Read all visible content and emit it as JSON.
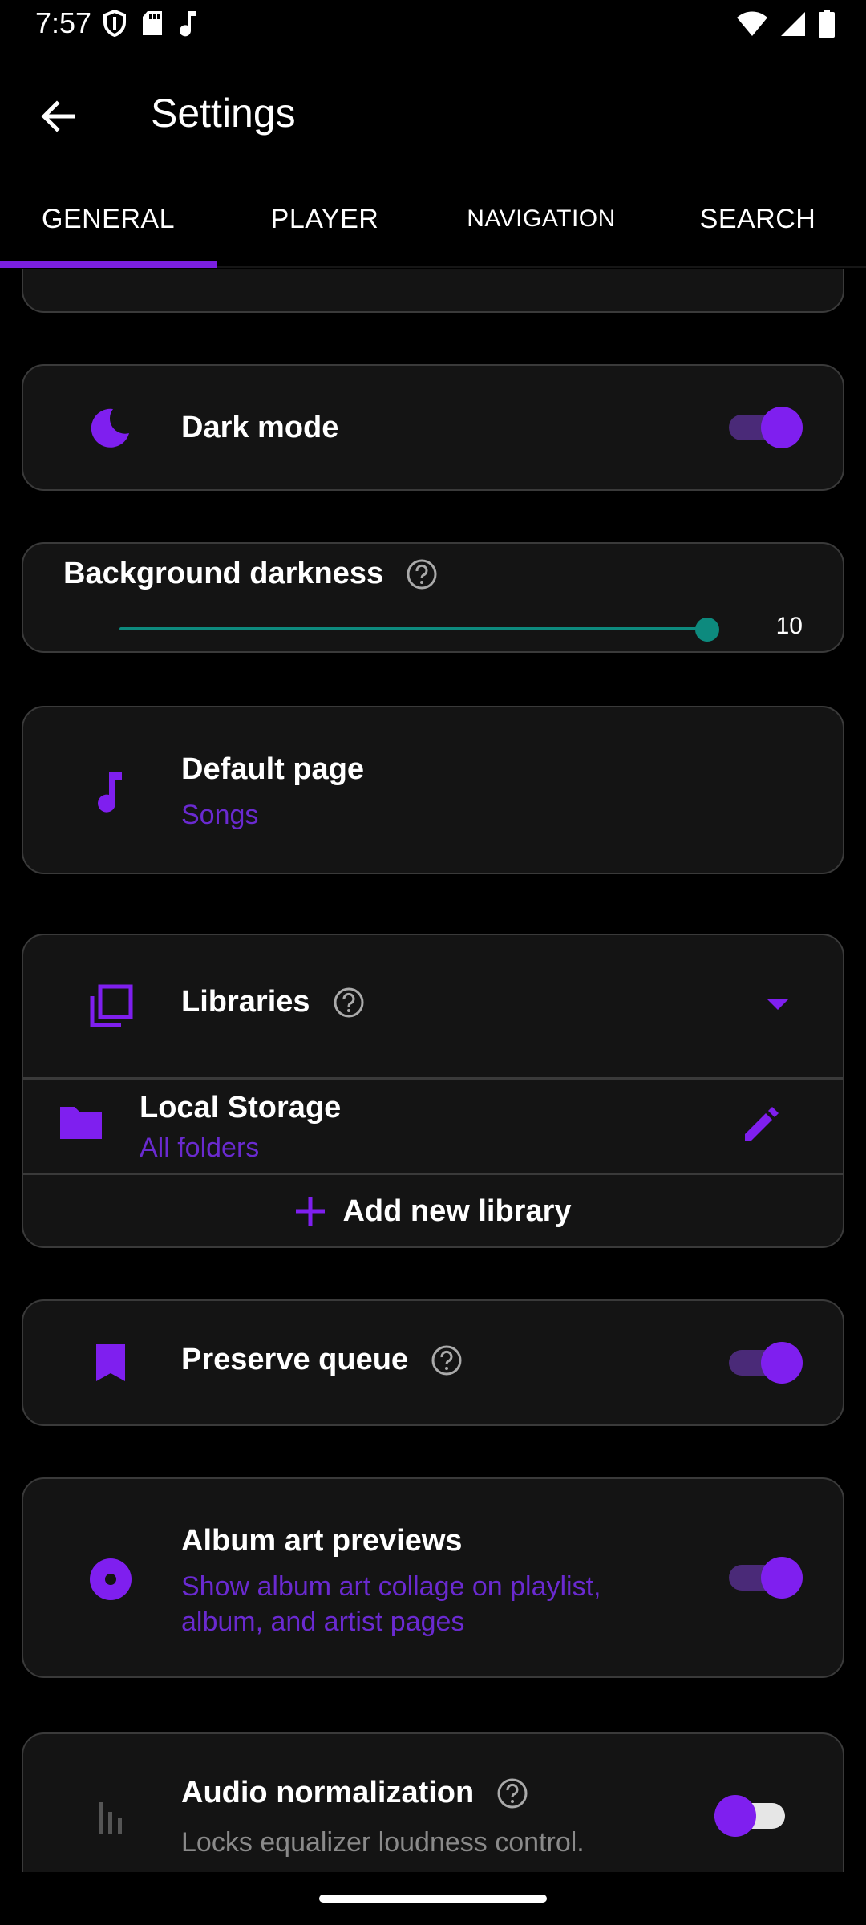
{
  "status_bar": {
    "time": "7:57",
    "left_icons": [
      "shield-icon",
      "sd-card-icon",
      "music-note-icon"
    ],
    "right_icons": [
      "wifi-icon",
      "signal-icon",
      "battery-icon"
    ]
  },
  "app_bar": {
    "title": "Settings",
    "back_icon": "arrow-back-icon"
  },
  "tabs": [
    {
      "label": "GENERAL",
      "active": true
    },
    {
      "label": "PLAYER",
      "active": false
    },
    {
      "label": "NAVIGATION",
      "active": false
    },
    {
      "label": "SEARCH",
      "active": false
    }
  ],
  "accent_color": "#7f1fef",
  "settings": {
    "dark_mode": {
      "title": "Dark mode",
      "icon": "moon-icon",
      "enabled": true
    },
    "background_darkness": {
      "title": "Background darkness",
      "value": "10",
      "level": 1.0
    },
    "default_page": {
      "title": "Default page",
      "value": "Songs",
      "icon": "music-note-icon"
    },
    "libraries": {
      "title": "Libraries",
      "icon": "library-icon",
      "items": [
        {
          "name": "Local Storage",
          "sub": "All folders",
          "icon": "folder-icon",
          "edit_icon": "pencil-icon"
        }
      ],
      "add_label": "Add new library"
    },
    "preserve_queue": {
      "title": "Preserve queue",
      "icon": "bookmark-icon",
      "enabled": true
    },
    "album_art_previews": {
      "title": "Album art previews",
      "sub_line1": "Show album art collage on playlist,",
      "sub_line2": "album, and artist pages",
      "icon": "album-icon",
      "enabled": true
    },
    "audio_normalization": {
      "title": "Audio normalization",
      "sub": "Locks equalizer loudness control.",
      "icon": "equalizer-icon",
      "enabled": false
    }
  }
}
